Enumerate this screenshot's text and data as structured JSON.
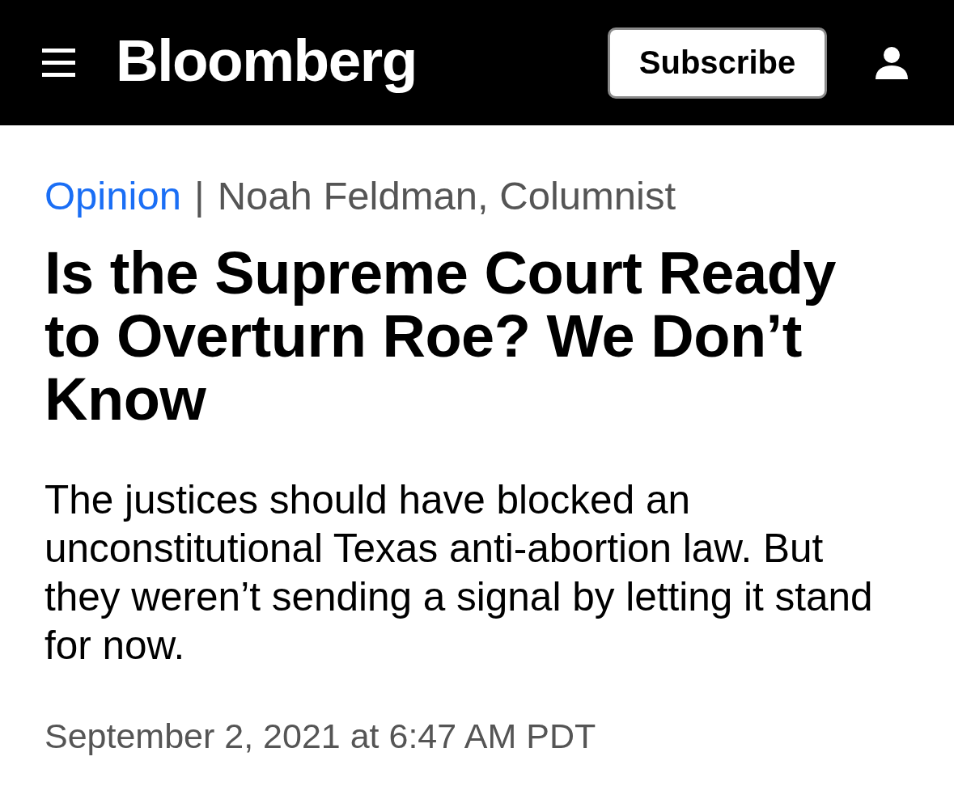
{
  "header": {
    "logo": "Bloomberg",
    "subscribe_button": "Subscribe"
  },
  "article": {
    "section": "Opinion",
    "separator": "|",
    "byline": "Noah Feldman, Columnist",
    "headline": "Is the Supreme Court Ready to Overturn Roe? We Don’t Know",
    "deck": "The justices should have blocked an unconstitutional Texas anti-abortion law. But they weren’t sending a signal by letting it stand for now.",
    "timestamp": "September 2, 2021 at 6:47 AM PDT"
  }
}
